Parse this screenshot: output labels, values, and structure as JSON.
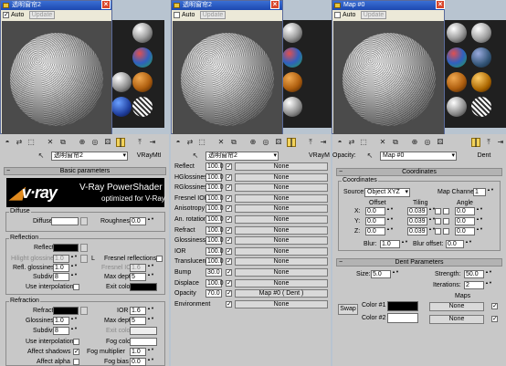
{
  "window1": {
    "title": "透明窗帘2",
    "auto_label": "Auto",
    "auto_checked": true,
    "update_label": "Update"
  },
  "window2": {
    "title": "透明窗帘2",
    "auto_label": "Auto",
    "update_label": "Update"
  },
  "window3": {
    "title": "Map #0",
    "auto_label": "Auto",
    "update_label": "Update"
  },
  "colors": {
    "titlebar": "#2a5ccc",
    "panel": "#c8c8c8",
    "rollout": "#b3b3b3",
    "vray_orange": "#e08a1e"
  },
  "left_panel": {
    "material_name": "透明窗帘2",
    "material_type": "VRayMtl",
    "basic_parameters_title": "Basic parameters",
    "vray_title": "V-Ray PowerShader",
    "vray_subtitle": "optimized for V-Ray",
    "vray_logo": "v·ray",
    "diffuse_group": "Diffuse",
    "diffuse_label": "Diffuse",
    "roughness_label": "Roughness",
    "roughness_value": "0.0",
    "reflection_group": "Reflection",
    "reflect_label": "Reflect",
    "hilight_glossiness_label": "Hilight glossiness",
    "hilight_glossiness_value": "1.0",
    "l_label": "L",
    "fresnel_reflections_label": "Fresnel reflections",
    "refl_glossiness_label": "Refl. glossiness",
    "refl_glossiness_value": "1.0",
    "fresnel_ior_label": "Fresnel IOR",
    "fresnel_ior_value": "1.6",
    "subdivs_label": "Subdivs",
    "subdivs_value": "8",
    "max_depth_label": "Max depth",
    "max_depth_value": "5",
    "use_interpolation_label": "Use interpolation",
    "exit_color_label": "Exit color",
    "refraction_group": "Refraction",
    "refract_label": "Refract",
    "ior_label": "IOR",
    "ior_value": "1.6",
    "glossiness_label": "Glossiness",
    "glossiness_value": "1.0",
    "r_max_depth_label": "Max depth",
    "r_max_depth_value": "5",
    "r_subdivs_label": "Subdivs",
    "r_subdivs_value": "8",
    "r_exit_color_label": "Exit color",
    "r_use_interpolation_label": "Use interpolation",
    "fog_color_label": "Fog color",
    "affect_shadows_label": "Affect shadows",
    "fog_multiplier_label": "Fog multiplier",
    "fog_multiplier_value": "1.0",
    "affect_alpha_label": "Affect alpha",
    "fog_bias_label": "Fog bias",
    "fog_bias_value": "0.0"
  },
  "middle_panel": {
    "material_name": "透明窗帘2",
    "material_type": "VRayM",
    "none_label": "None",
    "rows": [
      {
        "label": "Reflect",
        "value": "100.0",
        "map": "None"
      },
      {
        "label": "HGlossiness",
        "value": "100.0",
        "map": "None"
      },
      {
        "label": "RGlossiness",
        "value": "100.0",
        "map": "None"
      },
      {
        "label": "Fresnel IOR",
        "value": "100.0",
        "map": "None"
      },
      {
        "label": "Anisotropy",
        "value": "100.0",
        "map": "None"
      },
      {
        "label": "An. rotation",
        "value": "100.0",
        "map": "None"
      },
      {
        "label": "Refract",
        "value": "100.0",
        "map": "None"
      },
      {
        "label": "Glossiness",
        "value": "100.0",
        "map": "None"
      },
      {
        "label": "IOR",
        "value": "100.0",
        "map": "None"
      },
      {
        "label": "Translucent",
        "value": "100.0",
        "map": "None"
      },
      {
        "label": "Bump",
        "value": "30.0",
        "map": "None"
      },
      {
        "label": "Displace",
        "value": "100.0",
        "map": "None"
      },
      {
        "label": "Opacity",
        "value": "70.0",
        "map": "Map #0 ( Dent )"
      },
      {
        "label": "Environment",
        "value": "",
        "map": "None"
      }
    ]
  },
  "right_panel": {
    "opacity_label": "Opacity:",
    "map_name": "Map #0",
    "map_type": "Dent",
    "coordinates_title": "Coordinates",
    "coordinates_group": "Coordinates",
    "source_label": "Source:",
    "source_value": "Object XYZ",
    "map_channel_label": "Map Channel:",
    "map_channel_value": "1",
    "offset_label": "Offset",
    "tiling_label": "Tiling",
    "angle_label": "Angle",
    "axes": [
      {
        "axis": "X:",
        "offset": "0.0",
        "tiling": "0.039",
        "angle": "0.0"
      },
      {
        "axis": "Y:",
        "offset": "0.0",
        "tiling": "0.039",
        "angle": "0.0"
      },
      {
        "axis": "Z:",
        "offset": "0.0",
        "tiling": "0.039",
        "angle": "0.0"
      }
    ],
    "blur_label": "Blur:",
    "blur_value": "1.0",
    "blur_offset_label": "Blur offset:",
    "blur_offset_value": "0.0",
    "dent_title": "Dent Parameters",
    "size_label": "Size:",
    "size_value": "5.0",
    "strength_label": "Strength:",
    "strength_value": "50.0",
    "iterations_label": "Iterations:",
    "iterations_value": "2",
    "maps_label": "Maps",
    "swap_label": "Swap",
    "color1_label": "Color #1",
    "color2_label": "Color #2",
    "none_label": "None"
  }
}
